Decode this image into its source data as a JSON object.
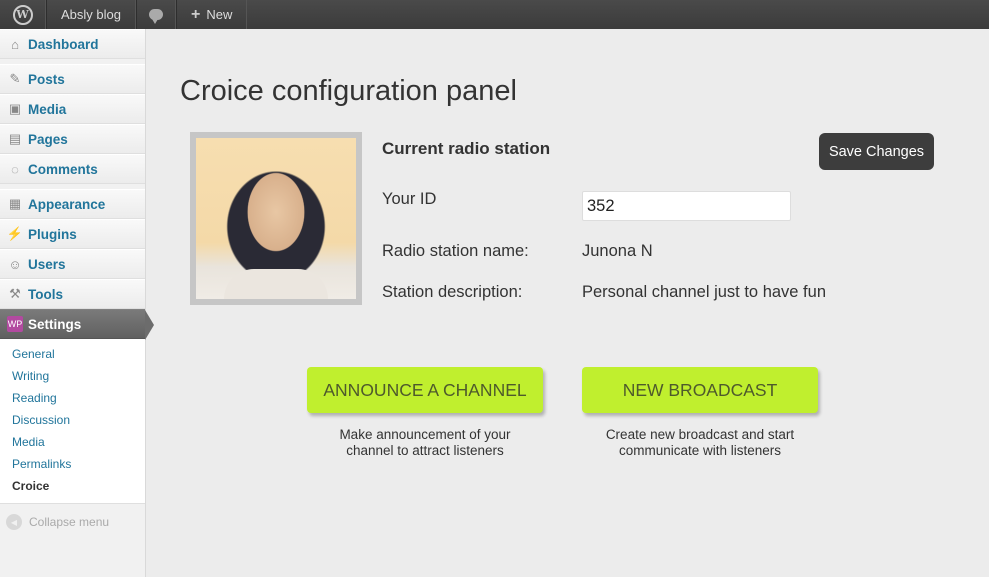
{
  "adminbar": {
    "logo_icon": "wordpress-logo-icon",
    "logo_glyph": "W",
    "site_name": "Absly blog",
    "comments_icon": "comment-bubble-icon",
    "new_label": "New"
  },
  "sidebar": {
    "items": [
      {
        "label": "Dashboard",
        "icon": "home-icon",
        "glyph": "⌂"
      },
      {
        "label": "Posts",
        "icon": "pin-icon",
        "glyph": "✎"
      },
      {
        "label": "Media",
        "icon": "media-icon",
        "glyph": "▣"
      },
      {
        "label": "Pages",
        "icon": "pages-icon",
        "glyph": "▤"
      },
      {
        "label": "Comments",
        "icon": "comments-icon",
        "glyph": "◌"
      },
      {
        "label": "Appearance",
        "icon": "appearance-icon",
        "glyph": "▦"
      },
      {
        "label": "Plugins",
        "icon": "plugins-icon",
        "glyph": "⚡"
      },
      {
        "label": "Users",
        "icon": "users-icon",
        "glyph": "☺"
      },
      {
        "label": "Tools",
        "icon": "tools-icon",
        "glyph": "⚒"
      },
      {
        "label": "Settings",
        "icon": "settings-icon",
        "glyph": "WP"
      }
    ],
    "submenu": [
      "General",
      "Writing",
      "Reading",
      "Discussion",
      "Media",
      "Permalinks",
      "Croice"
    ],
    "collapse_label": "Collapse menu"
  },
  "main": {
    "title": "Croice configuration panel",
    "section_label": "Current radio station",
    "save_label": "Save Changes",
    "id_label": "Your ID",
    "id_value": "352",
    "name_label": "Radio station name:",
    "name_value": "Junona N",
    "desc_label": "Station description:",
    "desc_value": "Personal channel just to have fun",
    "announce_label": "ANNOUNCE A CHANNEL",
    "announce_desc_1": "Make announcement of your",
    "announce_desc_2": "channel to attract listeners",
    "broadcast_label": "NEW BROADCAST",
    "broadcast_desc_1": "Create new broadcast and start",
    "broadcast_desc_2": "communicate with listeners"
  },
  "colors": {
    "accent_green": "#c0ef2e",
    "link_blue": "#21759b",
    "admin_bar": "#3b3b3b"
  }
}
